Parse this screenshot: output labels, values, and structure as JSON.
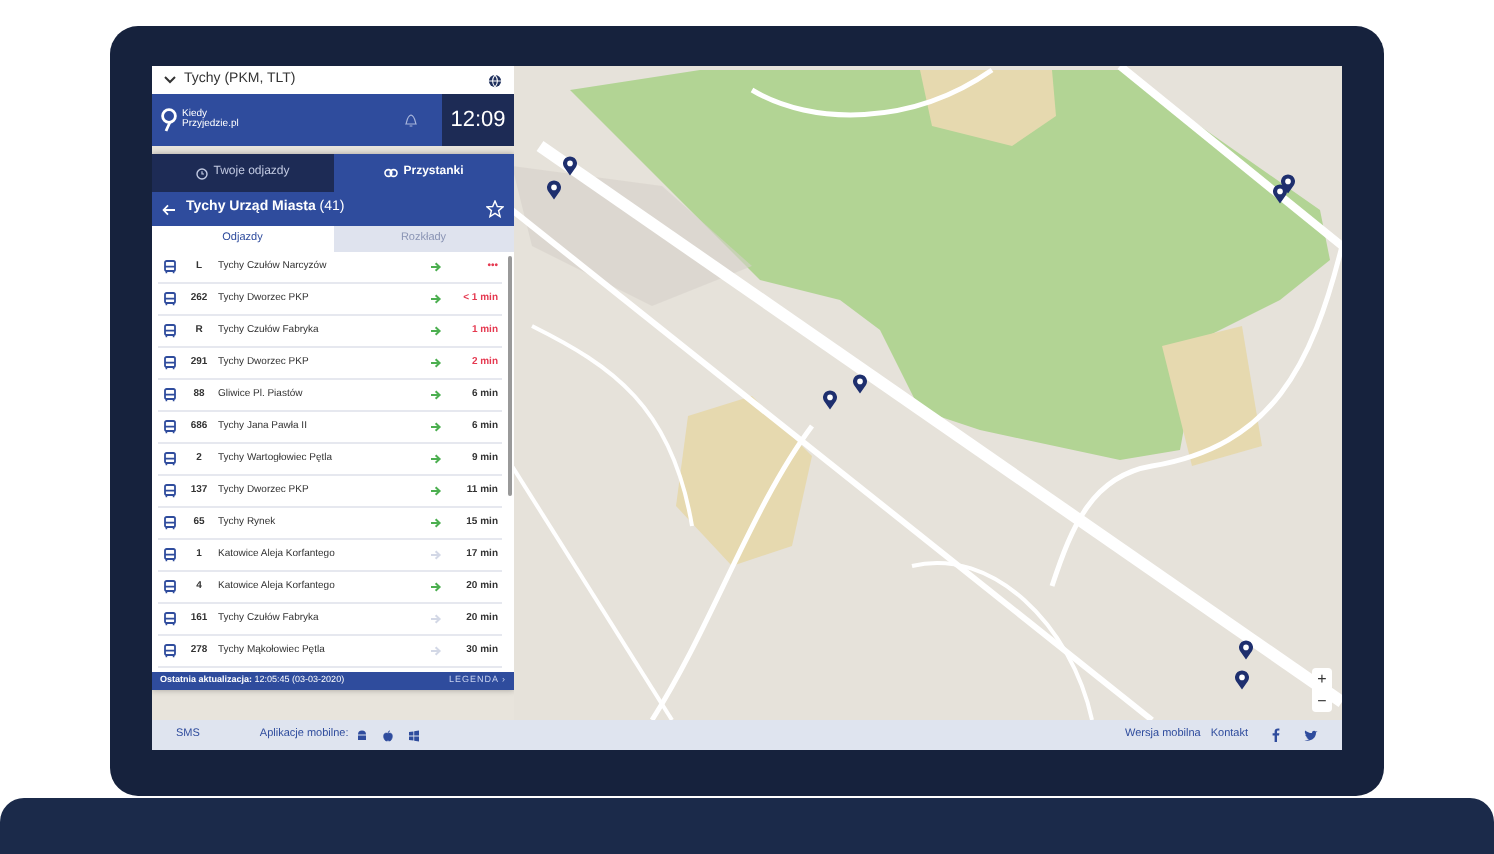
{
  "location_bar": {
    "value": "Tychy (PKM, TLT)"
  },
  "header": {
    "logo_line_1": "Kiedy",
    "logo_line_2": "Przyjedzie.pl",
    "clock": "12:09"
  },
  "tabs": [
    {
      "label": "Twoje odjazdy",
      "selected": false
    },
    {
      "label": "Przystanki",
      "selected": true
    }
  ],
  "stop": {
    "title": "**Tychy Urząd Miasta** (41)",
    "favorite": false
  },
  "subtabs": [
    {
      "label": "Odjazdy",
      "selected": true
    },
    {
      "label": "Rozkłady",
      "selected": false
    }
  ],
  "departures": [
    {
      "line": "L",
      "destination": "Tychy Czułów Narcyzów",
      "live": true,
      "time": "•••",
      "imminent": true
    },
    {
      "line": "262",
      "destination": "Tychy Dworzec PKP",
      "live": true,
      "time": "< 1 min",
      "imminent": true
    },
    {
      "line": "R",
      "destination": "Tychy Czułów Fabryka",
      "live": true,
      "time": "1 min",
      "imminent": true
    },
    {
      "line": "291",
      "destination": "Tychy Dworzec PKP",
      "live": true,
      "time": "2 min",
      "imminent": true
    },
    {
      "line": "88",
      "destination": "Gliwice Pl. Piastów",
      "live": true,
      "time": "6 min",
      "imminent": false
    },
    {
      "line": "686",
      "destination": "Tychy Jana Pawła II",
      "live": true,
      "time": "6 min",
      "imminent": false
    },
    {
      "line": "2",
      "destination": "Tychy Wartogłowiec Pętla",
      "live": true,
      "time": "9 min",
      "imminent": false
    },
    {
      "line": "137",
      "destination": "Tychy Dworzec PKP",
      "live": true,
      "time": "11 min",
      "imminent": false
    },
    {
      "line": "65",
      "destination": "Tychy Rynek",
      "live": true,
      "time": "15 min",
      "imminent": false
    },
    {
      "line": "1",
      "destination": "Katowice Aleja Korfantego",
      "live": false,
      "time": "17 min",
      "imminent": false
    },
    {
      "line": "4",
      "destination": "Katowice Aleja Korfantego",
      "live": true,
      "time": "20 min",
      "imminent": false
    },
    {
      "line": "161",
      "destination": "Tychy Czułów Fabryka",
      "live": false,
      "time": "20 min",
      "imminent": false
    },
    {
      "line": "278",
      "destination": "Tychy Mąkołowiec Pętla",
      "live": false,
      "time": "30 min",
      "imminent": false
    }
  ],
  "panel_footer": {
    "updated": "**Ostatnia aktualizacja:** 12:05:45 (03-03-2020)",
    "legend": "LEGENDA ›"
  },
  "map_controls": [
    "+",
    "−"
  ],
  "footer": {
    "sms": "SMS",
    "apps_label": "Aplikacje mobilne:",
    "mobile_version": "Wersja mobilna",
    "contact": "Kontakt"
  }
}
